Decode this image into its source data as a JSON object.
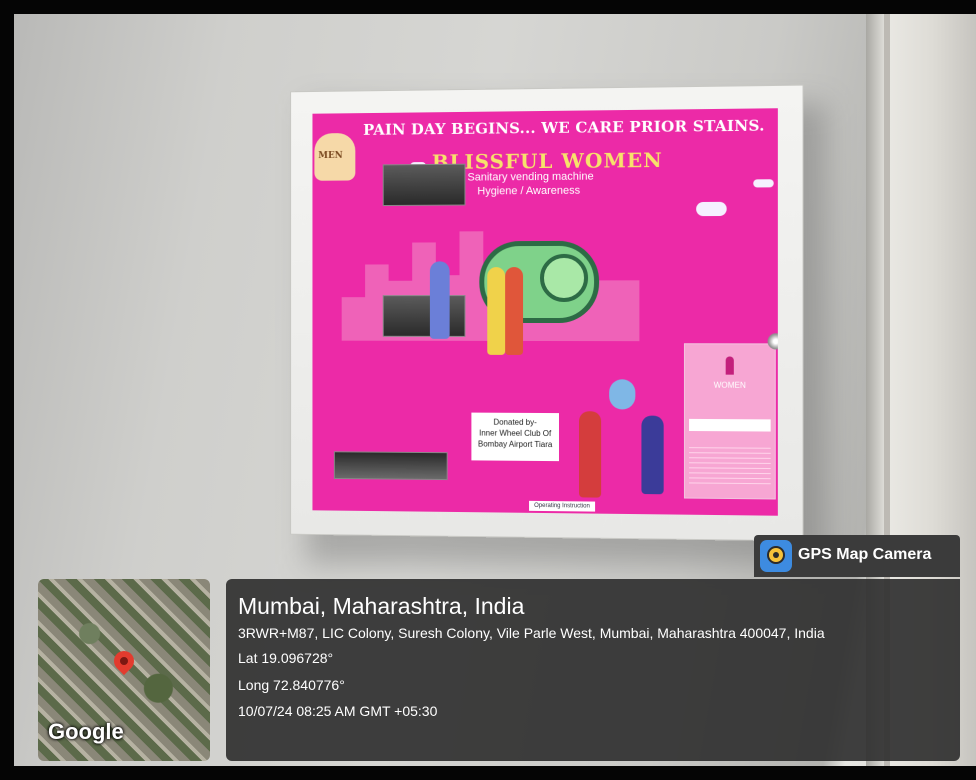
{
  "machine": {
    "headline": "PAIN DAY BEGINS... WE CARE PRIOR STAINS.",
    "logo_text": "MEN",
    "brand": "BLISSFUL WOMEN",
    "subtitle1": "Sanitary vending machine",
    "subtitle2": "Hygiene / Awareness",
    "donated": [
      "Donated by-",
      "Inner Wheel Club Of",
      "Bombay Airport Tiara"
    ],
    "women_label": "WOMEN",
    "operating_label": "Operating Instruction"
  },
  "overlay": {
    "badge_label": "GPS Map Camera",
    "map_logo": "Google",
    "city": "Mumbai, Maharashtra, India",
    "address": "3RWR+M87, LIC Colony, Suresh Colony, Vile Parle West, Mumbai, Maharashtra 400047, India",
    "lat": "Lat 19.096728°",
    "long": "Long 72.840776°",
    "timestamp": "10/07/24 08:25 AM GMT +05:30"
  }
}
